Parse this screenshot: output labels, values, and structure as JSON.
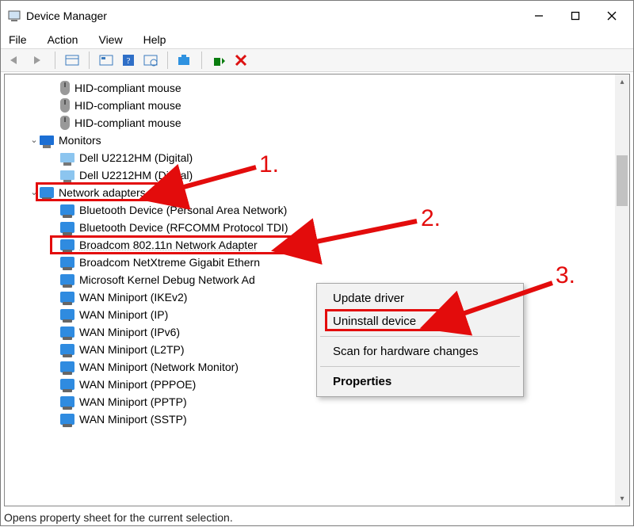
{
  "window": {
    "title": "Device Manager"
  },
  "menu": {
    "file": "File",
    "action": "Action",
    "view": "View",
    "help": "Help"
  },
  "tree": {
    "hid1": "HID-compliant mouse",
    "hid2": "HID-compliant mouse",
    "hid3": "HID-compliant mouse",
    "monitors": "Monitors",
    "mon1": "Dell U2212HM (Digital)",
    "mon2": "Dell U2212HM (Digital)",
    "netadapters": "Network adapters",
    "na1": "Bluetooth Device (Personal Area Network)",
    "na2": "Bluetooth Device (RFCOMM Protocol TDI)",
    "na3": "Broadcom 802.11n Network Adapter",
    "na4": "Broadcom NetXtreme Gigabit Ethern",
    "na5": "Microsoft Kernel Debug Network Ad",
    "na6": "WAN Miniport (IKEv2)",
    "na7": "WAN Miniport (IP)",
    "na8": "WAN Miniport (IPv6)",
    "na9": "WAN Miniport (L2TP)",
    "na10": "WAN Miniport (Network Monitor)",
    "na11": "WAN Miniport (PPPOE)",
    "na12": "WAN Miniport (PPTP)",
    "na13": "WAN Miniport (SSTP)"
  },
  "context_menu": {
    "update": "Update driver",
    "uninstall": "Uninstall device",
    "scan": "Scan for hardware changes",
    "properties": "Properties"
  },
  "status": "Opens property sheet for the current selection.",
  "annotations": {
    "n1": "1.",
    "n2": "2.",
    "n3": "3."
  }
}
